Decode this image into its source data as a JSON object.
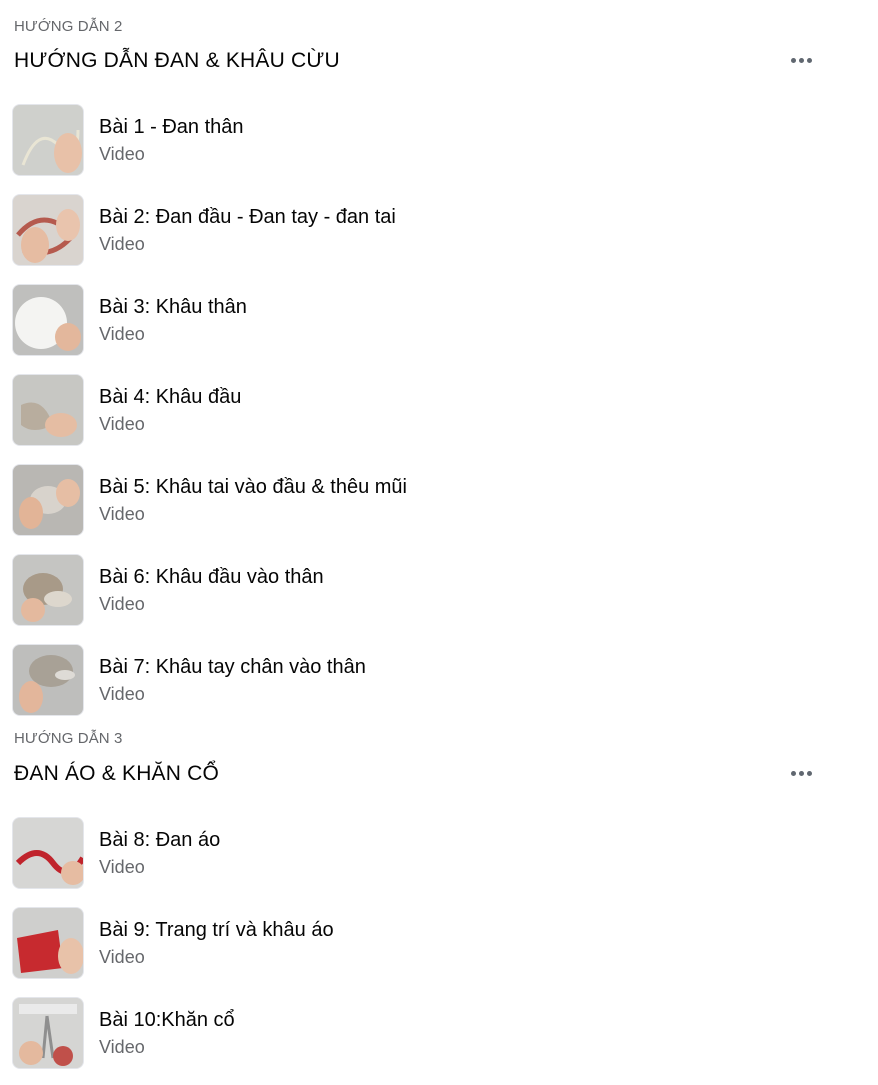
{
  "sections": [
    {
      "eyebrow": "HƯỚNG DẪN 2",
      "title": "HƯỚNG DẪN ĐAN & KHÂU CỪU",
      "more_icon": "more-horizontal-icon",
      "items": [
        {
          "title": "Bài 1 - Đan thân",
          "subtitle": "Video",
          "thumb": {
            "bg": "#cfd0cc",
            "accent": "#e6dcc8",
            "yarn": "#e9e5d4"
          }
        },
        {
          "title": "Bài 2: Đan đầu - Đan tay - đan tai",
          "subtitle": "Video",
          "thumb": {
            "bg": "#d9d4cf",
            "accent": "#c97d70",
            "yarn": "#b55a4e"
          }
        },
        {
          "title": "Bài 3: Khâu thân",
          "subtitle": "Video",
          "thumb": {
            "bg": "#bfbfbd",
            "accent": "#f4f4f2",
            "yarn": "#eeeeee"
          }
        },
        {
          "title": "Bài 4: Khâu đầu",
          "subtitle": "Video",
          "thumb": {
            "bg": "#c7c7c3",
            "accent": "#b8ad9e",
            "yarn": "#a99a88"
          }
        },
        {
          "title": "Bài 5: Khâu tai vào đầu & thêu mũi",
          "subtitle": "Video",
          "thumb": {
            "bg": "#b9b7b3",
            "accent": "#8c7a6a",
            "yarn": "#d8d3cc"
          }
        },
        {
          "title": "Bài 6: Khâu đầu vào thân",
          "subtitle": "Video",
          "thumb": {
            "bg": "#c5c5c2",
            "accent": "#a89a88",
            "yarn": "#ddd7cd"
          }
        },
        {
          "title": "Bài 7: Khâu tay chân vào thân",
          "subtitle": "Video",
          "thumb": {
            "bg": "#bebebc",
            "accent": "#a8a196",
            "yarn": "#dedbd6"
          }
        }
      ]
    },
    {
      "eyebrow": "HƯỚNG DẪN 3",
      "title": "ĐAN ÁO & KHĂN CỔ",
      "more_icon": "more-horizontal-icon",
      "items": [
        {
          "title": "Bài 8: Đan áo",
          "subtitle": "Video",
          "thumb": {
            "bg": "#d6d6d4",
            "accent": "#b81d24",
            "yarn": "#c0242c"
          }
        },
        {
          "title": "Bài 9: Trang trí và khâu áo",
          "subtitle": "Video",
          "thumb": {
            "bg": "#cfcfcd",
            "accent": "#b31c22",
            "yarn": "#c72a2f"
          }
        },
        {
          "title": "Bài 10:Khăn cổ",
          "subtitle": "Video",
          "thumb": {
            "bg": "#d5d5d3",
            "accent": "#8f8f8f",
            "yarn": "#c0504a"
          }
        }
      ]
    }
  ]
}
